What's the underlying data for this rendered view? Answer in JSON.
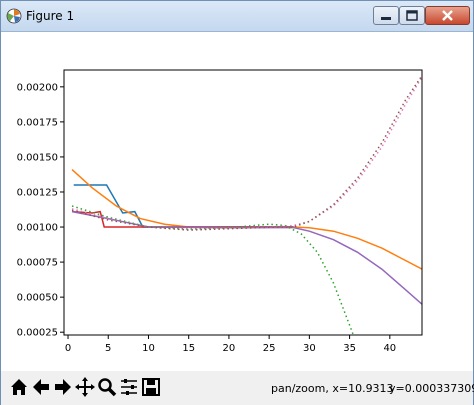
{
  "window": {
    "title": "Figure 1"
  },
  "toolbar": {
    "buttons": [
      {
        "name": "home-icon"
      },
      {
        "name": "back-arrow-icon"
      },
      {
        "name": "forward-arrow-icon"
      },
      {
        "name": "pan-icon"
      },
      {
        "name": "zoom-icon"
      },
      {
        "name": "subplots-config-icon"
      },
      {
        "name": "save-icon"
      }
    ],
    "status_mode": "pan/zoom, x=10.9313",
    "status_y": "y=0.000337309"
  },
  "chart_data": {
    "type": "line",
    "xlim": [
      -0.5,
      44
    ],
    "ylim": [
      0.00023,
      0.00212
    ],
    "x_ticks": [
      0,
      5,
      10,
      15,
      20,
      25,
      30,
      35,
      40
    ],
    "y_ticks": [
      0.00025,
      0.0005,
      0.00075,
      0.001,
      0.00125,
      0.0015,
      0.00175,
      0.002
    ],
    "x_tick_labels": [
      "0",
      "5",
      "10",
      "15",
      "20",
      "25",
      "30",
      "35",
      "40"
    ],
    "y_tick_labels": [
      "0.00025",
      "0.00050",
      "0.00075",
      "0.00100",
      "0.00125",
      "0.00150",
      "0.00175",
      "0.00200"
    ],
    "grid": false,
    "series": [
      {
        "color": "#1f77b4",
        "style": "solid",
        "points": [
          [
            0.7,
            0.0013
          ],
          [
            4.8,
            0.0013
          ],
          [
            6.8,
            0.0011
          ],
          [
            8.3,
            0.00111
          ],
          [
            9.3,
            0.001
          ],
          [
            28,
            0.001
          ]
        ]
      },
      {
        "color": "#ff7f0e",
        "style": "solid",
        "points": [
          [
            0.5,
            0.00141
          ],
          [
            3,
            0.00128
          ],
          [
            6,
            0.00115
          ],
          [
            9,
            0.00106
          ],
          [
            12,
            0.00102
          ],
          [
            15,
            0.001
          ],
          [
            20,
            0.000995
          ],
          [
            25,
            0.000998
          ],
          [
            28,
            0.001
          ],
          [
            30,
            0.000995
          ],
          [
            33,
            0.00097
          ],
          [
            36,
            0.00092
          ],
          [
            39,
            0.00085
          ],
          [
            41,
            0.00079
          ],
          [
            44,
            0.0007
          ]
        ]
      },
      {
        "color": "#d62728",
        "style": "solid",
        "points": [
          [
            0.5,
            0.00111
          ],
          [
            3,
            0.0011
          ],
          [
            4,
            0.00111
          ],
          [
            4.5,
            0.001
          ],
          [
            28,
            0.001
          ]
        ]
      },
      {
        "color": "#9467bd",
        "style": "solid",
        "points": [
          [
            0.5,
            0.00111
          ],
          [
            5,
            0.00106
          ],
          [
            10,
            0.001
          ],
          [
            20,
            0.000995
          ],
          [
            28,
            0.000997
          ],
          [
            30,
            0.00097
          ],
          [
            33,
            0.00091
          ],
          [
            36,
            0.00082
          ],
          [
            39,
            0.0007
          ],
          [
            42,
            0.00055
          ],
          [
            44,
            0.00045
          ]
        ]
      },
      {
        "color": "#2ca02c",
        "style": "dotted",
        "points": [
          [
            0.5,
            0.00115
          ],
          [
            5,
            0.00107
          ],
          [
            10,
            0.001
          ],
          [
            15,
            0.000985
          ],
          [
            20,
            0.000995
          ],
          [
            25,
            0.00102
          ],
          [
            27,
            0.00101
          ],
          [
            29,
            0.00095
          ],
          [
            31,
            0.00082
          ],
          [
            33,
            0.0006
          ],
          [
            35,
            0.0003
          ],
          [
            35.8,
            0.00018
          ]
        ]
      },
      {
        "color": "#e377c2",
        "style": "dotted",
        "points": [
          [
            0.5,
            0.00113
          ],
          [
            5,
            0.00106
          ],
          [
            10,
            0.001
          ],
          [
            15,
            0.00098
          ],
          [
            20,
            0.00099
          ],
          [
            25,
            0.001
          ],
          [
            28,
            0.00101
          ],
          [
            30,
            0.00104
          ],
          [
            33,
            0.00115
          ],
          [
            36,
            0.00133
          ],
          [
            39,
            0.00157
          ],
          [
            42,
            0.00188
          ],
          [
            44,
            0.00207
          ]
        ]
      },
      {
        "color": "#8c564b",
        "style": "dotted",
        "points": [
          [
            0.5,
            0.00112
          ],
          [
            5,
            0.00105
          ],
          [
            10,
            0.001
          ],
          [
            15,
            0.000978
          ],
          [
            20,
            0.000988
          ],
          [
            25,
            0.000998
          ],
          [
            28,
            0.001
          ],
          [
            30,
            0.00104
          ],
          [
            33,
            0.00116
          ],
          [
            36,
            0.00135
          ],
          [
            39,
            0.0016
          ],
          [
            42,
            0.00191
          ],
          [
            44,
            0.00208
          ]
        ]
      }
    ]
  }
}
